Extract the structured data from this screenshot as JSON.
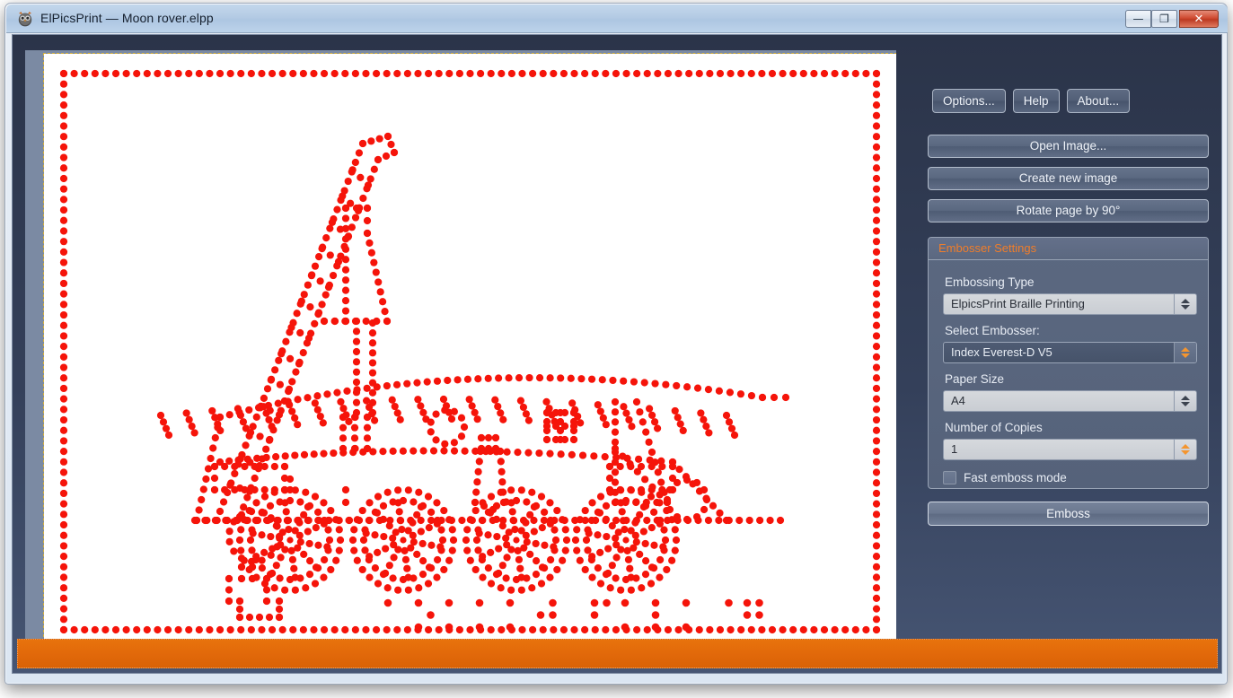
{
  "window": {
    "title": "ElPicsPrint — Moon rover.elpp",
    "icon": "owl-icon",
    "controls": {
      "minimize": "—",
      "maximize": "❐",
      "close": "✕"
    }
  },
  "toolbar": {
    "options_label": "Options...",
    "help_label": "Help",
    "about_label": "About..."
  },
  "actions": {
    "open_image_label": "Open Image...",
    "create_new_image_label": "Create new image",
    "rotate_page_label": "Rotate page by 90°",
    "emboss_label": "Emboss"
  },
  "embosser_settings": {
    "title": "Embosser Settings",
    "title_color": "#f07d2a",
    "embossing_type": {
      "label": "Embossing Type",
      "value": "ElpicsPrint Braille Printing",
      "spinner_color": "#3c434f"
    },
    "select_embosser": {
      "label": "Select Embosser:",
      "value": "Index Everest-D V5",
      "spinner_color": "#f4952f"
    },
    "paper_size": {
      "label": "Paper Size",
      "value": "A4",
      "spinner_color": "#3c434f"
    },
    "number_of_copies": {
      "label": "Number of Copies",
      "value": "1",
      "spinner_color": "#f4952f"
    },
    "fast_emboss_mode": {
      "label": "Fast emboss mode",
      "checked": false
    }
  },
  "canvas": {
    "page_background": "#ffffff",
    "viewport_background": "#7b8aa3",
    "selection_border_color": "#d8b23c",
    "dot_color": "#f5140a",
    "artwork_title": "Moon rover tactile dot drawing"
  },
  "status_bar": {
    "color": "#e2690a"
  },
  "theme": {
    "panel_background": "#34405a",
    "titlebar_background": "#b4cbe4",
    "accent_orange": "#f07d2a"
  }
}
